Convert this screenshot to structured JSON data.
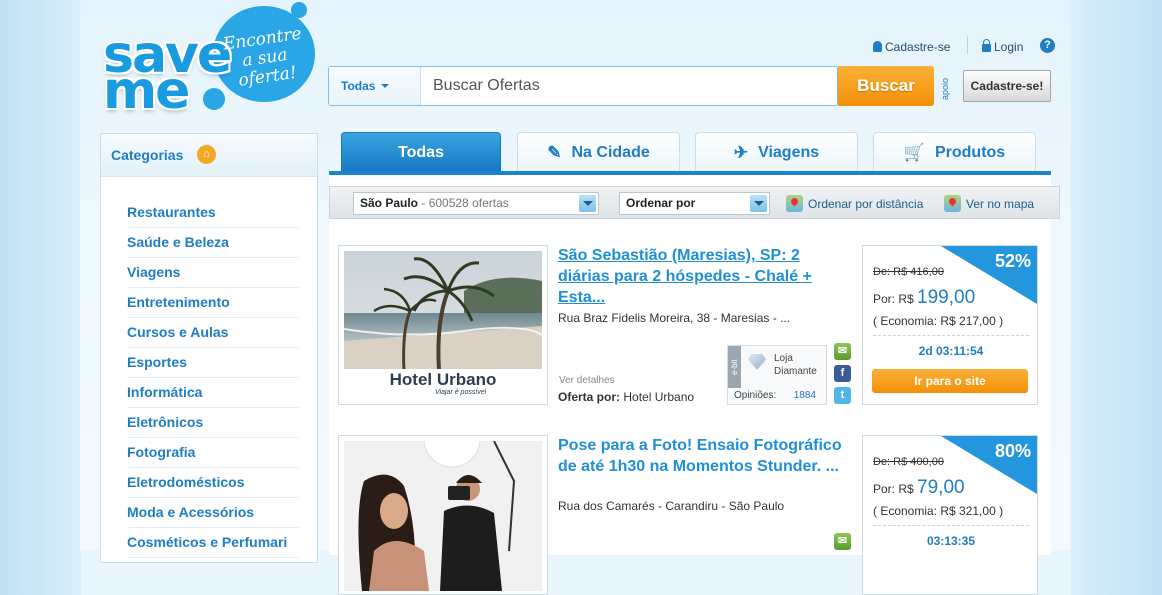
{
  "logo": {
    "word_top": "save",
    "word_bottom": "me",
    "tagline": [
      "Encontre",
      "a sua",
      "oferta!"
    ]
  },
  "header": {
    "signup_link": "Cadastre-se",
    "login_link": "Login",
    "help": "?",
    "apoio": "apoio",
    "signup_button": "Cadastre-se!"
  },
  "search": {
    "category": "Todas",
    "placeholder": "Buscar Ofertas",
    "button": "Buscar"
  },
  "sidebar": {
    "title": "Categorias",
    "items": [
      "Restaurantes",
      "Saúde e Beleza",
      "Viagens",
      "Entretenimento",
      "Cursos e Aulas",
      "Esportes",
      "Informática",
      "Eletrônicos",
      "Fotografia",
      "Eletrodomésticos",
      "Moda e Acessórios",
      "Cosméticos e Perfumari"
    ]
  },
  "tabs": [
    {
      "label": "Todas",
      "icon": ""
    },
    {
      "label": "Na Cidade",
      "icon": "tag-icon"
    },
    {
      "label": "Viagens",
      "icon": "plane-icon"
    },
    {
      "label": "Produtos",
      "icon": "cart-icon"
    }
  ],
  "filters": {
    "city": "São Paulo",
    "count": "- 600528 ofertas",
    "sort": "Ordenar por",
    "sort_distance": "Ordenar por distância",
    "map": "Ver no mapa"
  },
  "offers": [
    {
      "image_brand": "Hotel Urbano",
      "image_slogan": "Viajar é possível",
      "title": "São Sebastião (Maresias), SP: 2 diárias para 2 hóspedes - Chalé + Esta...",
      "address": "Rua Braz Fidelis Moreira, 38 - Maresias - ...",
      "more": "Ver detalhes",
      "by_label": "Oferta por:",
      "by": "Hotel Urbano",
      "ebit_tag": "e-bit",
      "ebit_store": [
        "Loja",
        "Diamante"
      ],
      "ebit_reviews_label": "Opiniões:",
      "ebit_reviews": "1884",
      "discount": "52%",
      "old_price": "De: R$ 416,00",
      "price_label": "Por: R$",
      "price": "199,00",
      "savings": "( Economia: R$ 217,00 )",
      "timer": "2d 03:11:54",
      "cta": "Ir para o site"
    },
    {
      "title": "Pose para a Foto! Ensaio Fotográfico de até 1h30 na Momentos Stunder. ...",
      "address": "Rua dos Camarés - Carandiru - São Paulo",
      "discount": "80%",
      "old_price": "De: R$ 400,00",
      "price_label": "Por: R$",
      "price": "79,00",
      "savings": "( Economia: R$ 321,00 )",
      "timer": "03:13:35"
    }
  ],
  "colors": {
    "brand_blue": "#1f7dc4",
    "orange": "#f29005",
    "badge_blue": "#2496de"
  }
}
